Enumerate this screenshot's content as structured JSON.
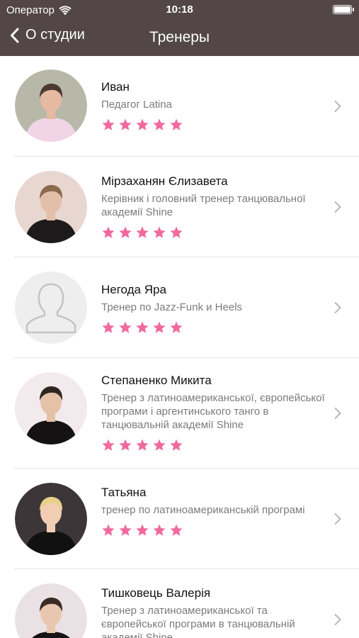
{
  "status_bar": {
    "carrier": "Оператор",
    "time": "10:18",
    "icons": [
      "wifi-icon",
      "battery-icon"
    ]
  },
  "nav": {
    "back_label": "О студии",
    "title": "Тренеры"
  },
  "colors": {
    "header_bg": "#524646",
    "star": "#f06a9e",
    "chevron": "#b9b9b9"
  },
  "trainers": [
    {
      "name": "Иван",
      "desc": "Педагог Latina",
      "rating": 5,
      "avatar": "photo"
    },
    {
      "name": "Мірзаханян Єлизавета",
      "desc": "Керівник і головний тренер танцювальної академії Shine",
      "rating": 5,
      "avatar": "photo"
    },
    {
      "name": "Негода Яра",
      "desc": "Тренер по Jazz-Funk и Heels",
      "rating": 5,
      "avatar": "placeholder"
    },
    {
      "name": "Степаненко Микита",
      "desc": "Тренер з латиноамериканської, європейської програми і аргентинського танго в танцювальній академії Shine",
      "rating": 5,
      "avatar": "photo"
    },
    {
      "name": "Татьяна",
      "desc": "тренер по латиноамериканській програмі",
      "rating": 5,
      "avatar": "photo"
    },
    {
      "name": "Тишковець Валерія",
      "desc": "Тренер з латиноамериканської та європейської програми в танцювальній академії Shine",
      "rating": 5,
      "avatar": "photo"
    }
  ]
}
